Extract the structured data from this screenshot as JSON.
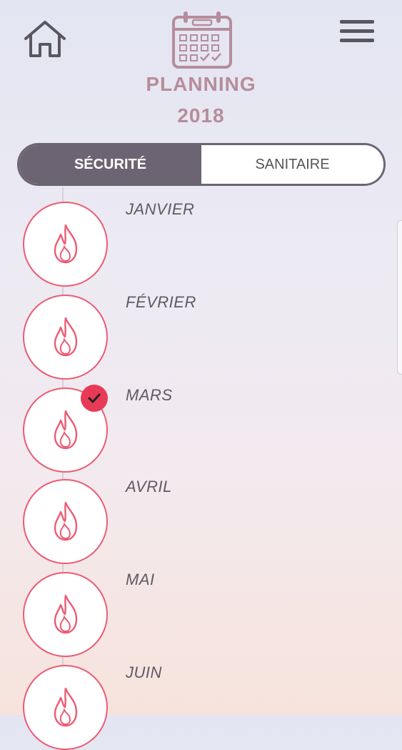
{
  "header": {
    "title_line1": "PLANNING",
    "title_line2": "2018",
    "icons": {
      "home": "home-icon",
      "menu": "hamburger-menu-icon",
      "calendar": "calendar-icon"
    }
  },
  "tabs": [
    {
      "label": "SÉCURITÉ",
      "active": true
    },
    {
      "label": "SANITAIRE",
      "active": false
    }
  ],
  "months": [
    {
      "label": "JANVIER",
      "done": false,
      "icon": "flame-icon"
    },
    {
      "label": "FÉVRIER",
      "done": false,
      "icon": "flame-icon"
    },
    {
      "label": "MARS",
      "done": true,
      "icon": "flame-icon"
    },
    {
      "label": "AVRIL",
      "done": false,
      "icon": "flame-icon"
    },
    {
      "label": "MAI",
      "done": false,
      "icon": "flame-icon"
    },
    {
      "label": "JUIN",
      "done": false,
      "icon": "flame-icon"
    }
  ],
  "colors": {
    "accent": "#ec5b74",
    "check_badge": "#e83a57",
    "tab_active_bg": "#6d6473",
    "title": "#b68d9b",
    "month_text": "#5e5a64"
  }
}
